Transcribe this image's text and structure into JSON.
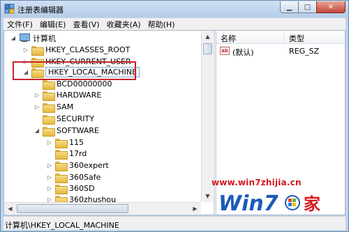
{
  "window": {
    "title": "注册表编辑器",
    "icon": "regedit-icon",
    "buttons": [
      "minimize-icon",
      "maximize-icon",
      "close-icon"
    ]
  },
  "menu": {
    "items": [
      "文件(F)",
      "编辑(E)",
      "查看(V)",
      "收藏夹(A)",
      "帮助(H)"
    ]
  },
  "tree": {
    "root": "计算机",
    "nodes": [
      {
        "label": "HKEY_CLASSES_ROOT"
      },
      {
        "label": "HKEY_CURRENT_USER"
      },
      {
        "label": "HKEY_LOCAL_MACHINE",
        "selected": true,
        "highlighted": true
      },
      {
        "label": "BCD00000000"
      },
      {
        "label": "HARDWARE"
      },
      {
        "label": "SAM"
      },
      {
        "label": "SECURITY"
      },
      {
        "label": "SOFTWARE",
        "expanded": true
      },
      {
        "label": "115"
      },
      {
        "label": "17rd"
      },
      {
        "label": "360expert"
      },
      {
        "label": "360Safe"
      },
      {
        "label": "360SD"
      },
      {
        "label": "360zhushou"
      }
    ]
  },
  "list": {
    "columns": [
      "名称",
      "类型"
    ],
    "rows": [
      {
        "name": "(默认)",
        "type": "REG_SZ",
        "icon": "ab-string-icon"
      }
    ]
  },
  "status": {
    "path": "计算机\\HKEY_LOCAL_MACHINE"
  },
  "watermark": {
    "url": "www.win7zhijia.cn",
    "logo_text": "Win7",
    "logo_suffix": "家"
  },
  "colors": {
    "highlight": "#c8232c",
    "watermark": "#d7181f",
    "logo_blue": "#1c5bb8"
  }
}
